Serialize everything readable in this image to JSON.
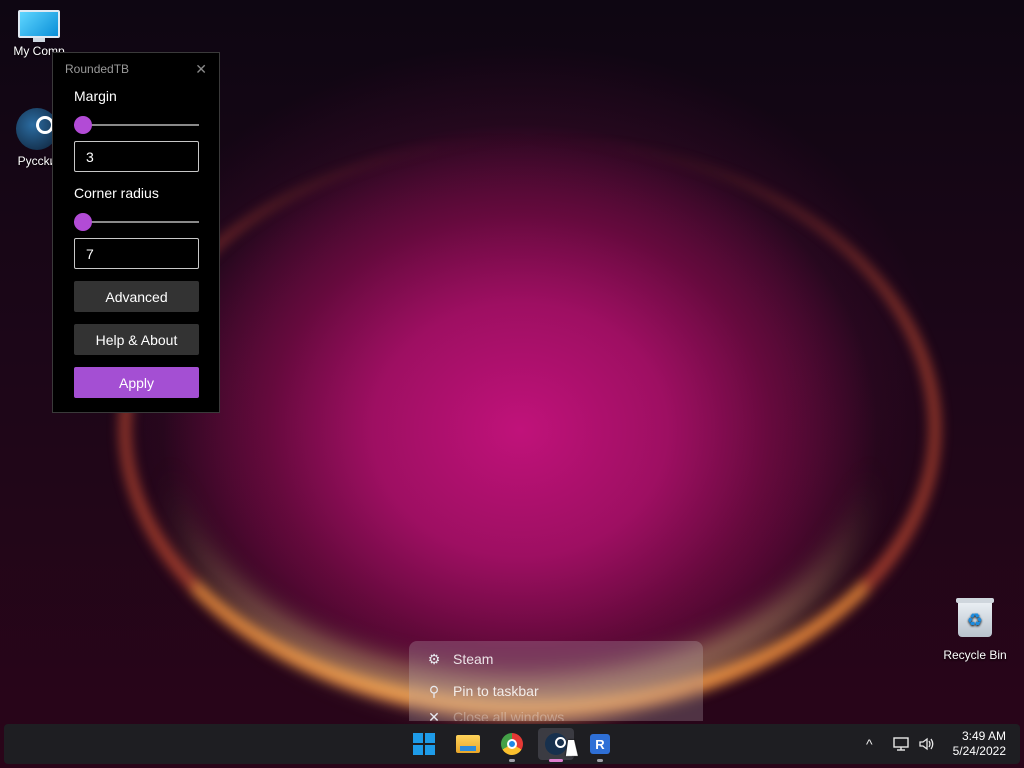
{
  "desktop": {
    "icons": [
      {
        "label": "My Comp",
        "icon": "monitor-icon"
      },
      {
        "label": "Pycckи",
        "icon": "steam-icon"
      },
      {
        "label": "Recycle Bin",
        "icon": "recycle-bin-icon"
      }
    ]
  },
  "roundedtb": {
    "title": "RoundedTB",
    "close_glyph": "✕",
    "margin": {
      "label": "Margin",
      "value": "3",
      "slider_fraction": 0.0
    },
    "corner_radius": {
      "label": "Corner radius",
      "value": "7",
      "slider_fraction": 0.0
    },
    "advanced_label": "Advanced",
    "help_label": "Help & About",
    "apply_label": "Apply",
    "accent_color": "#a44fd3"
  },
  "context_menu": {
    "items": [
      {
        "label": "Steam",
        "icon": "steam-icon"
      },
      {
        "label": "Pin to taskbar",
        "icon": "pin-icon"
      },
      {
        "label": "Close all windows",
        "icon": "close-icon"
      }
    ]
  },
  "taskbar": {
    "apps": [
      {
        "name": "start",
        "icon": "windows-start-icon"
      },
      {
        "name": "file-explorer",
        "icon": "folder-icon"
      },
      {
        "name": "chrome",
        "icon": "chrome-icon"
      },
      {
        "name": "steam",
        "icon": "steam-icon",
        "active": true
      },
      {
        "name": "roundedtb",
        "icon": "roundedtb-icon",
        "letter": "R"
      }
    ],
    "tray": {
      "chevron": "^",
      "network_icon": "network-icon",
      "volume_icon": "volume-icon"
    },
    "clock": {
      "time": "3:49 AM",
      "date": "5/24/2022"
    }
  }
}
